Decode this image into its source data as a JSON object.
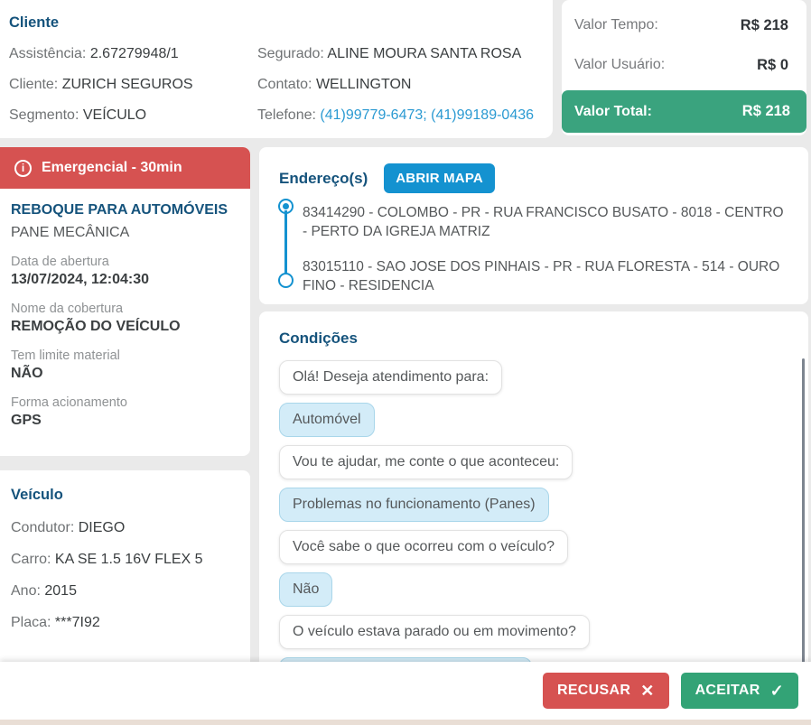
{
  "client": {
    "title": "Cliente",
    "fields_left": [
      {
        "label": "Assistência:",
        "value": "2.67279948/1"
      },
      {
        "label": "Cliente:",
        "value": "ZURICH SEGUROS"
      },
      {
        "label": "Segmento:",
        "value": "VEÍCULO"
      }
    ],
    "fields_right": [
      {
        "label": "Segurado:",
        "value": "ALINE MOURA SANTA ROSA"
      },
      {
        "label": "Contato:",
        "value": "WELLINGTON"
      },
      {
        "label": "Telefone:",
        "value": "(41)99779-6473; (41)99189-0436"
      }
    ]
  },
  "pricing": {
    "rows": [
      {
        "label": "Valor Tempo:",
        "value": "R$ 218"
      },
      {
        "label": "Valor Usuário:",
        "value": "R$ 0"
      }
    ],
    "total_label": "Valor Total:",
    "total_value": "R$ 218"
  },
  "service": {
    "banner": "Emergencial - 30min",
    "title": "REBOQUE PARA AUTOMÓVEIS",
    "subtitle": "PANE MECÂNICA",
    "details": [
      {
        "label": "Data de abertura",
        "value": "13/07/2024, 12:04:30"
      },
      {
        "label": "Nome da cobertura",
        "value": "REMOÇÃO DO VEÍCULO"
      },
      {
        "label": "Tem limite material",
        "value": "NÃO"
      },
      {
        "label": "Forma acionamento",
        "value": "GPS"
      }
    ]
  },
  "vehicle": {
    "title": "Veículo",
    "fields": [
      {
        "label": "Condutor:",
        "value": "DIEGO"
      },
      {
        "label": "Carro:",
        "value": "KA SE 1.5 16V FLEX 5"
      },
      {
        "label": "Ano:",
        "value": "2015"
      },
      {
        "label": "Placa:",
        "value": "***7I92"
      }
    ]
  },
  "addresses": {
    "title": "Endereço(s)",
    "map_button": "ABRIR MAPA",
    "items": [
      "83414290 - COLOMBO - PR - RUA FRANCISCO BUSATO - 8018 - CENTRO - PERTO DA IGREJA MATRIZ",
      "83015110 - SAO JOSE DOS PINHAIS - PR - RUA FLORESTA - 514 - OURO FINO - RESIDENCIA"
    ]
  },
  "conditions": {
    "title": "Condições",
    "messages": [
      {
        "type": "question",
        "text": "Olá! Deseja atendimento para:"
      },
      {
        "type": "answer",
        "text": "Automóvel"
      },
      {
        "type": "question",
        "text": "Vou te ajudar, me conte o que aconteceu:"
      },
      {
        "type": "answer",
        "text": "Problemas no funcionamento (Panes)"
      },
      {
        "type": "question",
        "text": "Você sabe o que ocorreu com o veículo?"
      },
      {
        "type": "answer",
        "text": "Não"
      },
      {
        "type": "question",
        "text": "O veículo estava parado ou em movimento?"
      },
      {
        "type": "answer",
        "text": ""
      }
    ]
  },
  "footer": {
    "reject_label": "RECUSAR",
    "reject_icon": "✕",
    "accept_label": "ACEITAR",
    "accept_icon": "✓"
  },
  "icons": {
    "banner_info": "i"
  },
  "colors": {
    "heading_blue": "#15537c",
    "accent_blue": "#1492d0",
    "link_blue": "#2b9ad2",
    "danger_red": "#d65251",
    "success_green": "#33a376",
    "total_green": "#3aa37e",
    "background_gray": "#eaeaea",
    "bottom_strip_beige": "#e9ded5"
  }
}
